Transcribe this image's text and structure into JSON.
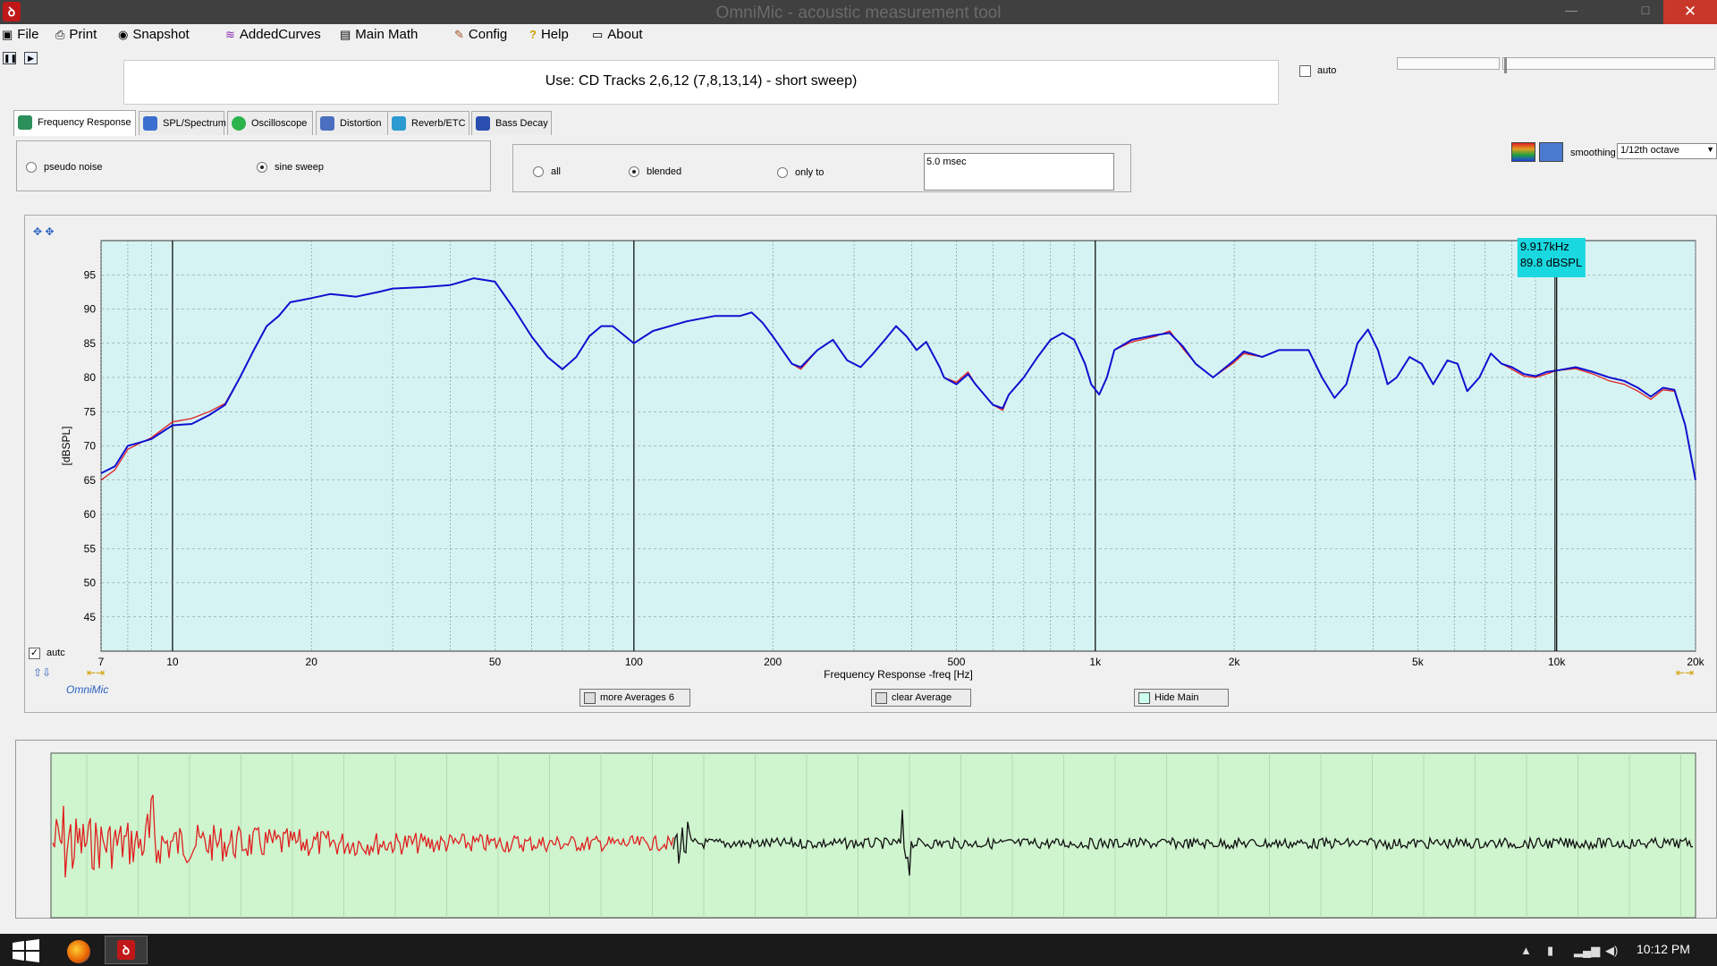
{
  "window": {
    "title": "OmniMic - acoustic measurement tool",
    "close": "✕",
    "maximize": "□",
    "minimize": "—"
  },
  "menu": [
    {
      "label": "File",
      "icon": "floppy-icon"
    },
    {
      "label": "Print",
      "icon": "printer-icon"
    },
    {
      "label": "Snapshot",
      "icon": "camera-icon"
    },
    {
      "label": "AddedCurves",
      "icon": "curves-icon"
    },
    {
      "label": "Main Math",
      "icon": "calculator-icon"
    },
    {
      "label": "Config",
      "icon": "wrench-icon"
    },
    {
      "label": "Help",
      "icon": "question-icon"
    },
    {
      "label": "About",
      "icon": "speech-bubble-icon"
    }
  ],
  "banner": {
    "text": "Use: CD Tracks 2,6,12 (7,8,13,14) - short sweep)"
  },
  "auto_checkbox": {
    "label": "auto",
    "checked": false
  },
  "tabs": [
    {
      "label": "Frequency Response",
      "icon": "frequency-icon",
      "color": "#2a8f5a",
      "active": true
    },
    {
      "label": "SPL/Spectrum",
      "icon": "spectrum-icon",
      "color": "#3a6fd0"
    },
    {
      "label": "Oscilloscope",
      "icon": "oscilloscope-icon",
      "color": "#2ab34a"
    },
    {
      "label": "Distortion",
      "icon": "distortion-icon",
      "color": "#4a6fc0"
    },
    {
      "label": "Reverb/ETC",
      "icon": "reverb-icon",
      "color": "#2a9ad0"
    },
    {
      "label": "Bass Decay",
      "icon": "bass-decay-icon",
      "color": "#2a4fb0"
    }
  ],
  "signal": {
    "pseudo_noise": "pseudo noise",
    "sine_sweep": "sine sweep",
    "selected": "sine sweep"
  },
  "window_mode": {
    "all": "all",
    "blended": "blended",
    "only_to": "only to",
    "selected": "blended",
    "time_value": "5.0 msec"
  },
  "smoothing": {
    "label": "smoothing",
    "value": "1/12th octave"
  },
  "chart_controls": {
    "autc_label": "autc",
    "autc_checked": true,
    "logo": "OmniMic",
    "more_averages": "more Averages 6",
    "clear_average": "clear Average",
    "hide_main": "Hide Main"
  },
  "chart_data": {
    "type": "line",
    "title": "",
    "xlabel": "Frequency Response -freq [Hz]",
    "ylabel": "[dBSPL]",
    "x_scale": "log",
    "xlim": [
      7,
      20000
    ],
    "ylim": [
      40,
      100
    ],
    "x_ticks": [
      {
        "value": 7,
        "label": "7"
      },
      {
        "value": 10,
        "label": "10"
      },
      {
        "value": 20,
        "label": "20"
      },
      {
        "value": 50,
        "label": "50"
      },
      {
        "value": 100,
        "label": "100"
      },
      {
        "value": 200,
        "label": "200"
      },
      {
        "value": 500,
        "label": "500"
      },
      {
        "value": 1000,
        "label": "1k"
      },
      {
        "value": 2000,
        "label": "2k"
      },
      {
        "value": 5000,
        "label": "5k"
      },
      {
        "value": 10000,
        "label": "10k"
      },
      {
        "value": 20000,
        "label": "20k"
      }
    ],
    "y_ticks": [
      45,
      50,
      55,
      60,
      65,
      70,
      75,
      80,
      85,
      90,
      95
    ],
    "grid": true,
    "background": "#d6f3f3",
    "series": [
      {
        "color": "#1010d0",
        "points": [
          [
            7,
            66
          ],
          [
            7.5,
            67
          ],
          [
            8,
            70
          ],
          [
            8.5,
            70.5
          ],
          [
            9,
            71
          ],
          [
            10,
            73
          ],
          [
            11,
            73.2
          ],
          [
            12,
            74.5
          ],
          [
            13,
            76
          ],
          [
            14,
            80
          ],
          [
            15,
            84
          ],
          [
            16,
            87.5
          ],
          [
            17,
            89
          ],
          [
            18,
            91
          ],
          [
            19,
            91.3
          ],
          [
            20,
            91.6
          ],
          [
            22,
            92.2
          ],
          [
            25,
            91.8
          ],
          [
            28,
            92.5
          ],
          [
            30,
            93
          ],
          [
            35,
            93.2
          ],
          [
            40,
            93.5
          ],
          [
            45,
            94.5
          ],
          [
            50,
            94
          ],
          [
            55,
            90
          ],
          [
            60,
            86
          ],
          [
            65,
            83
          ],
          [
            70,
            81.2
          ],
          [
            75,
            83
          ],
          [
            80,
            86
          ],
          [
            85,
            87.5
          ],
          [
            90,
            87.5
          ],
          [
            100,
            85
          ],
          [
            110,
            86.8
          ],
          [
            130,
            88.2
          ],
          [
            150,
            89
          ],
          [
            170,
            89
          ],
          [
            180,
            89.5
          ],
          [
            190,
            88
          ],
          [
            200,
            86
          ],
          [
            220,
            82
          ],
          [
            230,
            81.5
          ],
          [
            250,
            84
          ],
          [
            270,
            85.5
          ],
          [
            290,
            82.5
          ],
          [
            310,
            81.5
          ],
          [
            330,
            83.5
          ],
          [
            350,
            85.5
          ],
          [
            370,
            87.5
          ],
          [
            390,
            86
          ],
          [
            410,
            84
          ],
          [
            430,
            85.2
          ],
          [
            460,
            81.5
          ],
          [
            470,
            80
          ],
          [
            500,
            79
          ],
          [
            530,
            80.5
          ],
          [
            550,
            79
          ],
          [
            600,
            76
          ],
          [
            630,
            75.5
          ],
          [
            650,
            77.5
          ],
          [
            700,
            80
          ],
          [
            750,
            83
          ],
          [
            800,
            85.5
          ],
          [
            850,
            86.5
          ],
          [
            900,
            85.5
          ],
          [
            950,
            82
          ],
          [
            980,
            79
          ],
          [
            1020,
            77.5
          ],
          [
            1060,
            80
          ],
          [
            1100,
            84
          ],
          [
            1200,
            85.5
          ],
          [
            1350,
            86.2
          ],
          [
            1450,
            86.5
          ],
          [
            1550,
            84.5
          ],
          [
            1650,
            82
          ],
          [
            1800,
            80
          ],
          [
            2000,
            82.5
          ],
          [
            2100,
            83.8
          ],
          [
            2300,
            83
          ],
          [
            2500,
            84
          ],
          [
            2900,
            84
          ],
          [
            3100,
            80
          ],
          [
            3300,
            77
          ],
          [
            3500,
            79
          ],
          [
            3700,
            85
          ],
          [
            3900,
            87
          ],
          [
            4100,
            84
          ],
          [
            4300,
            79
          ],
          [
            4500,
            80
          ],
          [
            4800,
            83
          ],
          [
            5100,
            82
          ],
          [
            5400,
            79
          ],
          [
            5800,
            82.5
          ],
          [
            6100,
            82
          ],
          [
            6400,
            78
          ],
          [
            6800,
            80
          ],
          [
            7200,
            83.5
          ],
          [
            7600,
            82
          ],
          [
            8000,
            81.5
          ],
          [
            8500,
            80.5
          ],
          [
            9000,
            80.2
          ],
          [
            9500,
            80.8
          ],
          [
            10000,
            81
          ],
          [
            11000,
            81.5
          ],
          [
            12000,
            80.8
          ],
          [
            13000,
            80
          ],
          [
            14000,
            79.5
          ],
          [
            15000,
            78.5
          ],
          [
            16000,
            77.2
          ],
          [
            17000,
            78.5
          ],
          [
            18000,
            78.2
          ],
          [
            19000,
            73
          ],
          [
            20000,
            65
          ]
        ]
      },
      {
        "color": "#e02020",
        "points": [
          [
            7,
            65
          ],
          [
            7.5,
            66.5
          ],
          [
            8,
            69.5
          ],
          [
            8.5,
            70.4
          ],
          [
            9,
            71.2
          ],
          [
            10,
            73.5
          ],
          [
            11,
            74
          ],
          [
            12,
            75
          ],
          [
            13,
            76.2
          ],
          [
            14,
            80
          ],
          [
            15,
            84
          ],
          [
            16,
            87.5
          ],
          [
            17,
            89
          ],
          [
            18,
            91
          ],
          [
            19,
            91.3
          ],
          [
            20,
            91.6
          ],
          [
            22,
            92.2
          ],
          [
            25,
            91.8
          ],
          [
            28,
            92.5
          ],
          [
            30,
            93
          ],
          [
            35,
            93.2
          ],
          [
            40,
            93.5
          ],
          [
            45,
            94.5
          ],
          [
            50,
            94
          ],
          [
            55,
            90
          ],
          [
            60,
            86
          ],
          [
            65,
            83
          ],
          [
            70,
            81.2
          ],
          [
            75,
            83
          ],
          [
            80,
            86
          ],
          [
            85,
            87.5
          ],
          [
            90,
            87.5
          ],
          [
            100,
            85
          ],
          [
            110,
            86.8
          ],
          [
            130,
            88.2
          ],
          [
            150,
            89
          ],
          [
            170,
            89
          ],
          [
            180,
            89.5
          ],
          [
            190,
            88
          ],
          [
            200,
            86
          ],
          [
            220,
            82
          ],
          [
            230,
            81.2
          ],
          [
            250,
            84
          ],
          [
            270,
            85.5
          ],
          [
            290,
            82.5
          ],
          [
            310,
            81.5
          ],
          [
            330,
            83.5
          ],
          [
            350,
            85.5
          ],
          [
            370,
            87.5
          ],
          [
            390,
            86
          ],
          [
            410,
            84
          ],
          [
            430,
            85.2
          ],
          [
            460,
            81.5
          ],
          [
            470,
            80
          ],
          [
            500,
            79.3
          ],
          [
            530,
            80.8
          ],
          [
            550,
            79
          ],
          [
            600,
            76
          ],
          [
            630,
            75.2
          ],
          [
            650,
            77.5
          ],
          [
            700,
            80
          ],
          [
            750,
            83
          ],
          [
            800,
            85.5
          ],
          [
            850,
            86.5
          ],
          [
            900,
            85.5
          ],
          [
            950,
            82
          ],
          [
            980,
            79
          ],
          [
            1020,
            77.5
          ],
          [
            1060,
            80
          ],
          [
            1100,
            84
          ],
          [
            1200,
            85.2
          ],
          [
            1350,
            86
          ],
          [
            1450,
            86.8
          ],
          [
            1550,
            84.2
          ],
          [
            1650,
            82
          ],
          [
            1800,
            80
          ],
          [
            2000,
            82.2
          ],
          [
            2100,
            83.5
          ],
          [
            2300,
            83
          ],
          [
            2500,
            84
          ],
          [
            2900,
            84
          ],
          [
            3100,
            80
          ],
          [
            3300,
            77
          ],
          [
            3500,
            79
          ],
          [
            3700,
            85
          ],
          [
            3900,
            87
          ],
          [
            4100,
            84
          ],
          [
            4300,
            79
          ],
          [
            4500,
            80
          ],
          [
            4800,
            83
          ],
          [
            5100,
            82
          ],
          [
            5400,
            79
          ],
          [
            5800,
            82.5
          ],
          [
            6100,
            82
          ],
          [
            6400,
            78
          ],
          [
            6800,
            80
          ],
          [
            7200,
            83.5
          ],
          [
            7600,
            82
          ],
          [
            8000,
            81.2
          ],
          [
            8500,
            80.2
          ],
          [
            9000,
            80
          ],
          [
            9500,
            80.5
          ],
          [
            10000,
            81
          ],
          [
            11000,
            81.3
          ],
          [
            12000,
            80.5
          ],
          [
            13000,
            79.5
          ],
          [
            14000,
            79
          ],
          [
            15000,
            78
          ],
          [
            16000,
            76.8
          ],
          [
            17000,
            78.2
          ],
          [
            18000,
            78
          ],
          [
            19000,
            73
          ],
          [
            20000,
            65
          ]
        ]
      }
    ],
    "cursor": {
      "freq": 9917,
      "label_freq": "9.917kHz",
      "label_level": "89.8 dBSPL"
    }
  },
  "impulse": {
    "background": "#cff5cf",
    "red_color": "#e02020",
    "black_color": "#101010"
  },
  "taskbar": {
    "clock": "10:12 PM"
  }
}
